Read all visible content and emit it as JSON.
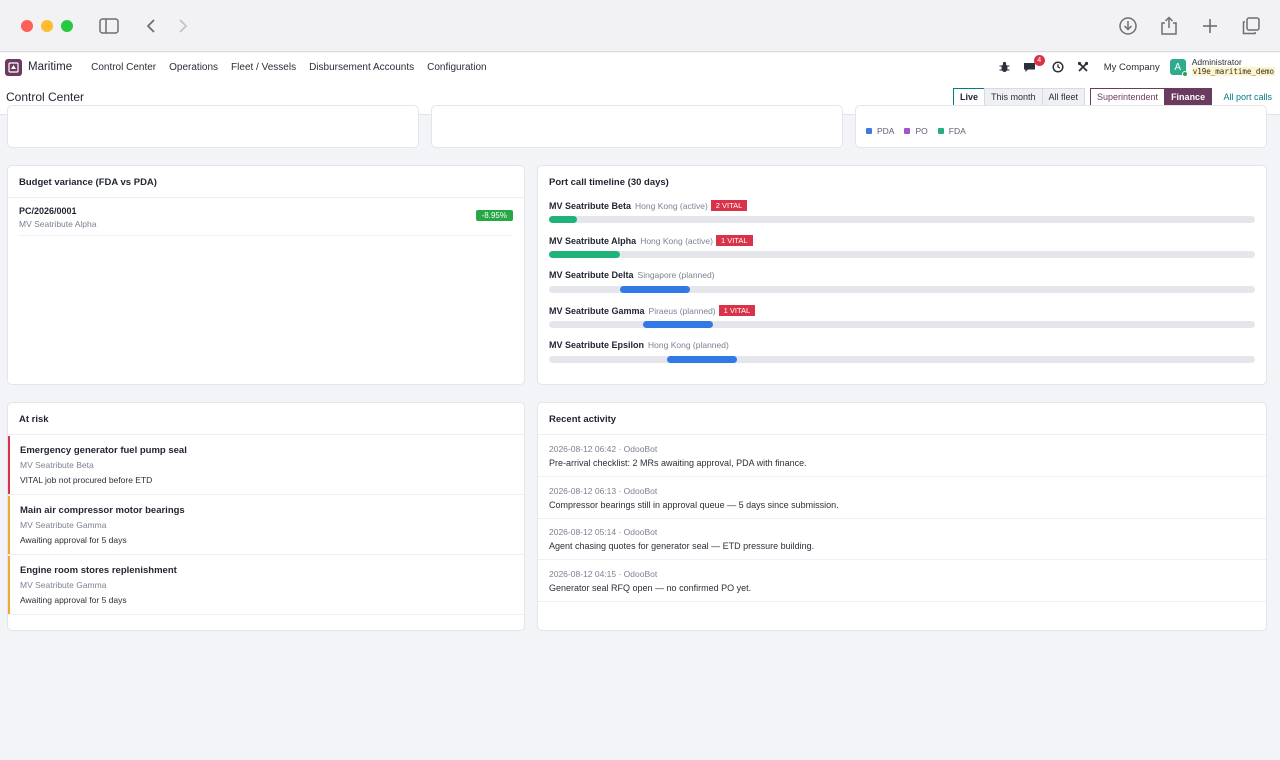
{
  "navbar": {
    "app_name": "Maritime",
    "menus": [
      "Control Center",
      "Operations",
      "Fleet / Vessels",
      "Disbursement Accounts",
      "Configuration"
    ],
    "messages_count": "4",
    "company": "My Company",
    "user_initial": "A",
    "user_name": "Administrator",
    "db_name": "v19e_maritime_demo"
  },
  "control_panel": {
    "title": "Control Center",
    "filters": [
      "Live",
      "This month",
      "All fleet"
    ],
    "roles": [
      "Superintendent",
      "Finance"
    ],
    "link": "All port calls"
  },
  "legend": [
    {
      "label": "PDA",
      "color": "#3d7be0"
    },
    {
      "label": "PO",
      "color": "#9b59d0"
    },
    {
      "label": "FDA",
      "color": "#24b07f"
    }
  ],
  "budget_variance": {
    "title": "Budget variance (FDA vs PDA)",
    "rows": [
      {
        "ref": "PC/2026/0001",
        "vessel": "MV Seatribute Alpha",
        "variance": "-8.95%"
      }
    ]
  },
  "timeline": {
    "title": "Port call timeline (30 days)",
    "rows": [
      {
        "vessel": "MV Seatribute Beta",
        "loc": "Hong Kong (active)",
        "vital": "2 VITAL",
        "start": 0.0,
        "end": 0.04,
        "color": "#1fb37a"
      },
      {
        "vessel": "MV Seatribute Alpha",
        "loc": "Hong Kong (active)",
        "vital": "1 VITAL",
        "start": 0.0,
        "end": 0.1,
        "color": "#1fb37a"
      },
      {
        "vessel": "MV Seatribute Delta",
        "loc": "Singapore (planned)",
        "vital": "",
        "start": 0.1,
        "end": 0.2,
        "color": "#2f7ae5"
      },
      {
        "vessel": "MV Seatribute Gamma",
        "loc": "Piraeus (planned)",
        "vital": "1 VITAL",
        "start": 0.133,
        "end": 0.233,
        "color": "#2f7ae5"
      },
      {
        "vessel": "MV Seatribute Epsilon",
        "loc": "Hong Kong (planned)",
        "vital": "",
        "start": 0.167,
        "end": 0.267,
        "color": "#2f7ae5"
      }
    ]
  },
  "at_risk": {
    "title": "At risk",
    "items": [
      {
        "title": "Emergency generator fuel pump seal",
        "vessel": "MV Seatribute Beta",
        "reason": "VITAL job not procured before ETD",
        "color": "#d9334a"
      },
      {
        "title": "Main air compressor motor bearings",
        "vessel": "MV Seatribute Gamma",
        "reason": "Awaiting approval for 5 days",
        "color": "#f0a830"
      },
      {
        "title": "Engine room stores replenishment",
        "vessel": "MV Seatribute Gamma",
        "reason": "Awaiting approval for 5 days",
        "color": "#f0a830"
      }
    ]
  },
  "activity": {
    "title": "Recent activity",
    "items": [
      {
        "meta": "2026-08-12 06:42 · OdooBot",
        "body": "Pre-arrival checklist: 2 MRs awaiting approval, PDA with finance."
      },
      {
        "meta": "2026-08-12 06:13 · OdooBot",
        "body": "Compressor bearings still in approval queue — 5 days since submission."
      },
      {
        "meta": "2026-08-12 05:14 · OdooBot",
        "body": "Agent chasing quotes for generator seal — ETD pressure building."
      },
      {
        "meta": "2026-08-12 04:15 · OdooBot",
        "body": "Generator seal RFQ open — no confirmed PO yet."
      }
    ]
  }
}
